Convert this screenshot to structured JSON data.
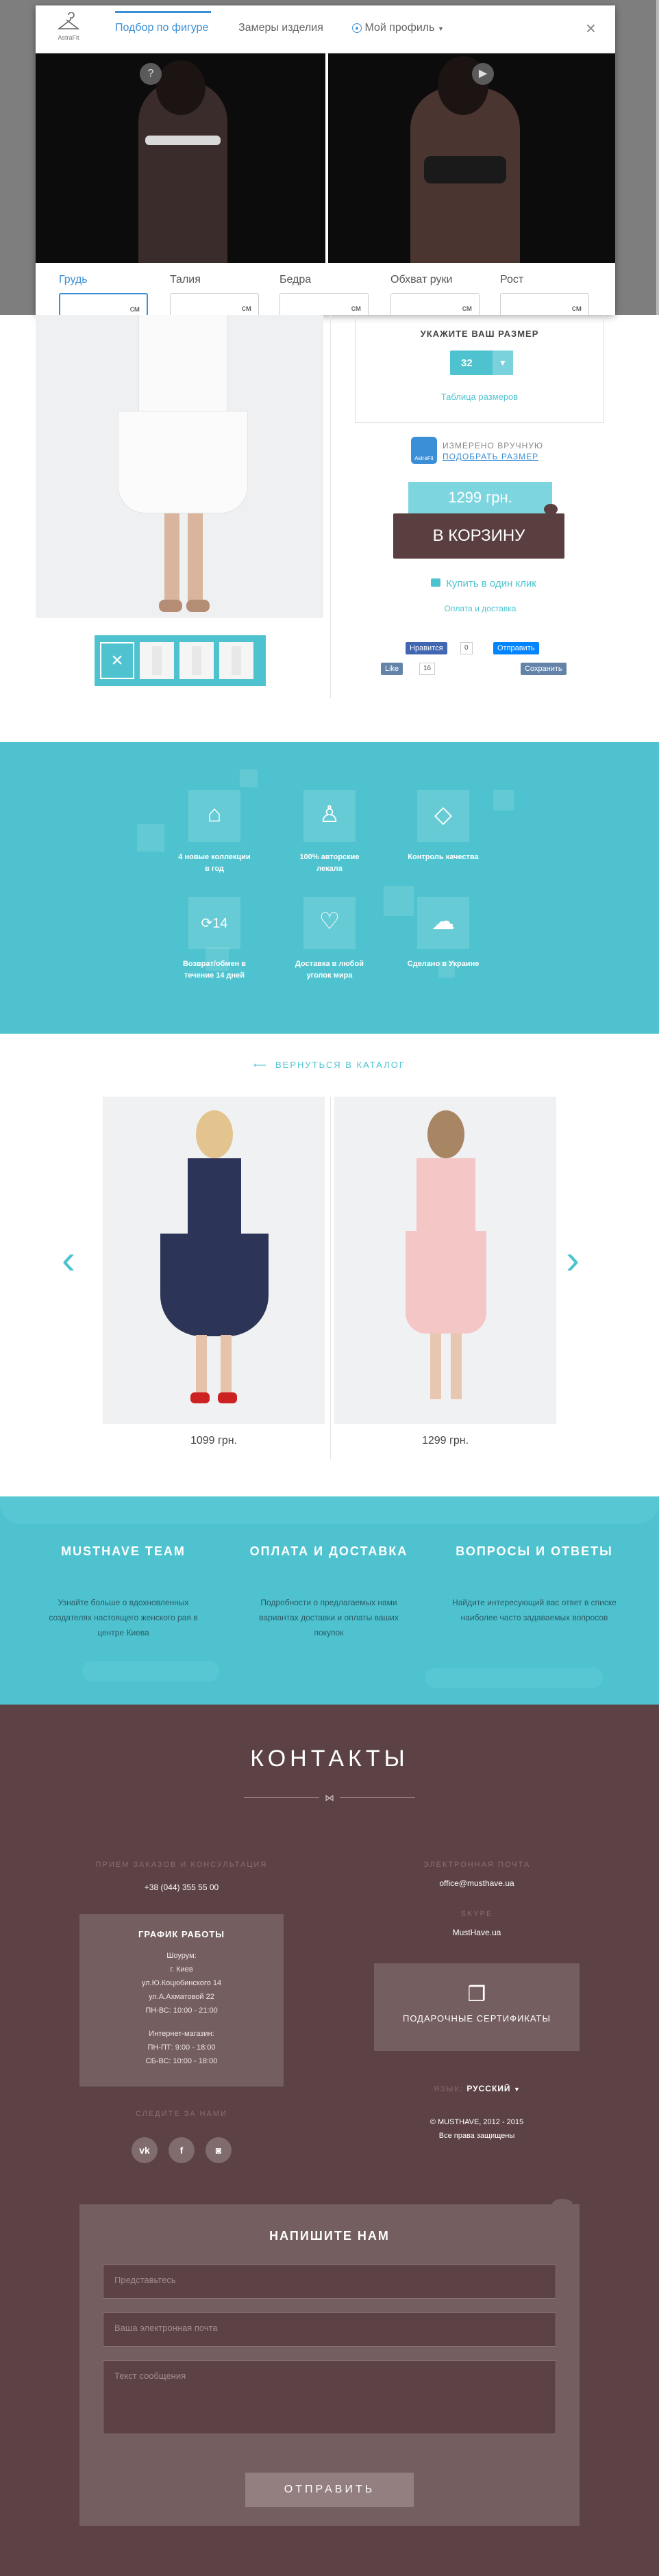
{
  "modal": {
    "logo_text": "AstraFit",
    "tabs": [
      "Подбор по фигуре",
      "Замеры изделия",
      "Мой профиль"
    ],
    "close": "×",
    "help_icon": "?",
    "video_icon": "▶",
    "fields": [
      {
        "label": "Грудь",
        "unit": "см"
      },
      {
        "label": "Талия",
        "unit": "см"
      },
      {
        "label": "Бедра",
        "unit": "см"
      },
      {
        "label": "Обхват руки",
        "unit": "см"
      },
      {
        "label": "Рост",
        "unit": "см"
      }
    ]
  },
  "product": {
    "size_title": "УКАЖИТЕ ВАШ РАЗМЕР",
    "size_value": "32",
    "size_table": "Таблица размеров",
    "measured_line1": "ИЗМЕРЕНО ВРУЧНУЮ",
    "measured_line2": "ПОДОБРАТЬ РАЗМЕР",
    "measured_logo": "AstraFit",
    "price": "1299 грн.",
    "to_cart": "В КОРЗИНУ",
    "one_click": "Купить в один клик",
    "delivery_link": "Оплата и доставка",
    "social": {
      "fb_like": "Нравится",
      "fb_count": "0",
      "fb_send": "Отправить",
      "vk_like": "Like",
      "vk_count": "16",
      "save": "Сохранить"
    }
  },
  "features": [
    {
      "icon": "hanger-icon",
      "text": "4 новые коллекции в год"
    },
    {
      "icon": "shirt-icon",
      "text": "100% авторские лекала"
    },
    {
      "icon": "diamond-icon",
      "text": "Контроль качества"
    },
    {
      "icon": "exchange-14-icon",
      "text": "Возврат/обмен в течение 14 дней"
    },
    {
      "icon": "shopping-bag-icon",
      "text": "Доставка в любой уголок мира"
    },
    {
      "icon": "ukraine-map-icon",
      "text": "Сделано в Украине"
    }
  ],
  "related": {
    "back_label": "ВЕРНУТЬСЯ В КАТАЛОГ",
    "items": [
      {
        "price": "1099 грн."
      },
      {
        "price": "1299 грн."
      }
    ]
  },
  "info": [
    {
      "title": "MUSTHAVE TEAM",
      "text": "Узнайте больше о вдохновленных создателях настоящего женского рая в центре Киева"
    },
    {
      "title": "ОПЛАТА И ДОСТАВКА",
      "text": "Подробности о предлагаемых нами вариантах доставки и оплаты ваших покупок"
    },
    {
      "title": "ВОПРОСЫ И ОТВЕТЫ",
      "text": "Найдите интересующий вас ответ в списке наиболее часто задаваемых вопросов"
    }
  ],
  "contacts": {
    "title": "КОНТАКТЫ",
    "orders_label": "ПРИЕМ ЗАКАЗОВ И КОНСУЛЬТАЦИЯ",
    "phone": "+38 (044) 355 55 00",
    "email_label": "ЭЛЕКТРОННАЯ ПОЧТА",
    "email": "office@musthave.ua",
    "skype_label": "SKYPE",
    "skype": "MustHave.ua",
    "hours_title": "ГРАФИК РАБОТЫ",
    "hours_lines_1": [
      "Шоурум:",
      "г. Киев",
      "ул.Ю.Коцюбинского 14",
      "ул.А.Ахматовой 22",
      "ПН-ВС: 10:00 - 21:00"
    ],
    "hours_lines_2": [
      "Интернет-магазин:",
      "ПН-ПТ: 9:00 - 18:00",
      "СБ-ВС: 10:00 - 18:00"
    ],
    "follow_label": "СЛЕДИТЕ ЗА НАМИ",
    "social": [
      "vk",
      "f",
      "◙"
    ],
    "gift_label": "ПОДАРОЧНЫЕ СЕРТИФИКАТЫ",
    "lang_label": "ЯЗЫК:",
    "lang_value": "РУССКИЙ",
    "copyright1": "© MUSTHAVE, 2012 - 2015",
    "copyright2": "Все права защищены"
  },
  "form": {
    "title": "НАПИШИТЕ НАМ",
    "name_placeholder": "Представьтесь",
    "email_placeholder": "Ваша электронная почта",
    "message_placeholder": "Текст сообщения",
    "submit": "ОТПРАВИТЬ"
  }
}
